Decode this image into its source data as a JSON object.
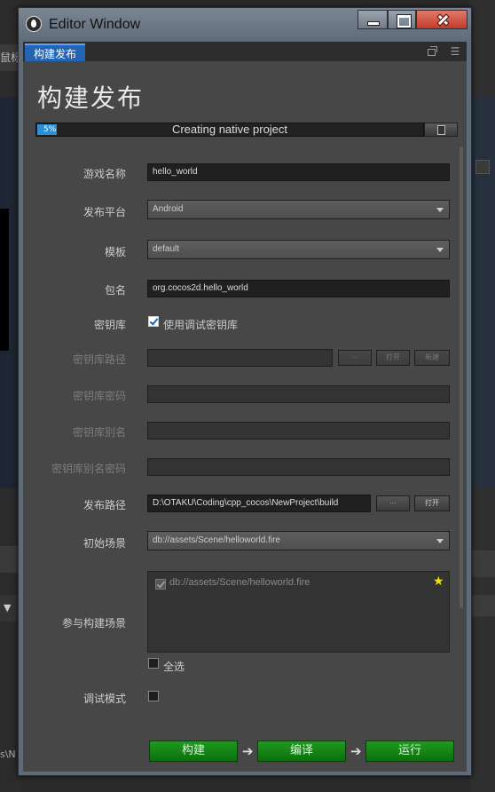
{
  "background": {
    "left_text_top": "鼠标",
    "left_text_mid": "▼",
    "left_text_bottom": "s\\N"
  },
  "window": {
    "title": "Editor Window"
  },
  "tab": {
    "label": "构建发布"
  },
  "page": {
    "title": "构建发布"
  },
  "progress": {
    "percent_label": "5%",
    "value": 0.05,
    "status": "Creating native project"
  },
  "form": {
    "game_name": {
      "label": "游戏名称",
      "value": "hello_world"
    },
    "platform": {
      "label": "发布平台",
      "value": "Android"
    },
    "template": {
      "label": "模板",
      "value": "default"
    },
    "package": {
      "label": "包名",
      "value": "org.cocos2d.hello_world"
    },
    "keystore": {
      "label": "密钥库",
      "checkbox_label": "使用调试密钥库",
      "checked": true
    },
    "keystore_path": {
      "label": "密钥库路径",
      "value": "",
      "btn_browse": "···",
      "btn_open": "打开",
      "btn_new": "新建"
    },
    "keystore_password": {
      "label": "密钥库密码",
      "value": ""
    },
    "keystore_alias": {
      "label": "密钥库别名",
      "value": ""
    },
    "keystore_alias_password": {
      "label": "密钥库别名密码",
      "value": ""
    },
    "build_path": {
      "label": "发布路径",
      "value": "D:\\OTAKU\\Coding\\cpp_cocos\\NewProject\\build",
      "btn_browse": "···",
      "btn_open": "打开"
    },
    "start_scene": {
      "label": "初始场景",
      "value": "db://assets/Scene/helloworld.fire"
    },
    "scenes": {
      "label": "参与构建场景",
      "items": [
        {
          "name": "db://assets/Scene/helloworld.fire",
          "checked": true
        }
      ],
      "select_all_label": "全选"
    },
    "debug": {
      "label": "调试模式",
      "checked": false
    }
  },
  "actions": {
    "build": "构建",
    "compile": "编译",
    "run": "运行"
  },
  "colors": {
    "accent_tab": "#2364b4",
    "progress_fill": "#2d8fd6",
    "action_green": "#1a8f1a",
    "star": "#f5e300"
  }
}
